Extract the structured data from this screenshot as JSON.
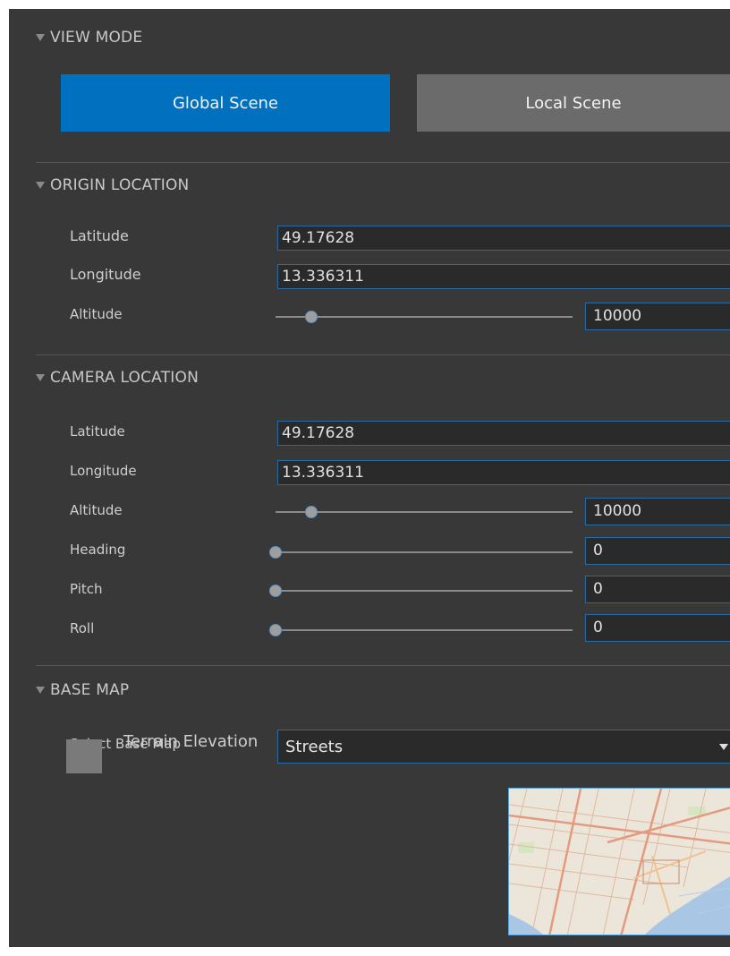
{
  "view_mode": {
    "header": "VIEW MODE",
    "global_scene_label": "Global Scene",
    "local_scene_label": "Local Scene",
    "selected": "Global Scene",
    "accent_color": "#0070bf",
    "inactive_color": "#6b6b6b"
  },
  "origin_location": {
    "header": "ORIGIN LOCATION",
    "latitude_label": "Latitude",
    "latitude_value": "49.17628",
    "longitude_label": "Longitude",
    "longitude_value": "13.336311",
    "altitude_label": "Altitude",
    "altitude_value": "10000"
  },
  "camera_location": {
    "header": "CAMERA LOCATION",
    "latitude_label": "Latitude",
    "latitude_value": "49.17628",
    "longitude_label": "Longitude",
    "longitude_value": "13.336311",
    "altitude_label": "Altitude",
    "altitude_value": "10000",
    "heading_label": "Heading",
    "heading_value": "0",
    "pitch_label": "Pitch",
    "pitch_value": "0",
    "roll_label": "Roll",
    "roll_value": "0"
  },
  "base_map": {
    "header": "BASE MAP",
    "select_label": "Select Base Map",
    "selected_value": "Streets",
    "terrain_label": "Terrain Elevation",
    "terrain_checked": false,
    "thumbnail_icon": "streets-map-thumbnail"
  },
  "sliders": {
    "origin_altitude_fraction": 0.12,
    "camera_altitude_fraction": 0.12,
    "heading_fraction": 0.0,
    "pitch_fraction": 0.0,
    "roll_fraction": 0.0
  }
}
